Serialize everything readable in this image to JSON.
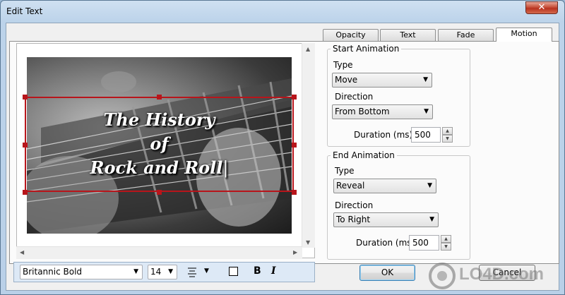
{
  "window": {
    "title": "Edit Text",
    "close_glyph": "✕"
  },
  "tabs": [
    {
      "label": "Opacity",
      "active": false
    },
    {
      "label": "Text",
      "active": false
    },
    {
      "label": "Fade",
      "active": false
    },
    {
      "label": "Motion",
      "active": true
    }
  ],
  "preview": {
    "text_lines": [
      "The History",
      "of",
      "Rock and Roll"
    ],
    "cursor": "|"
  },
  "start_animation": {
    "legend": "Start Animation",
    "type_label": "Type",
    "type_value": "Move",
    "direction_label": "Direction",
    "direction_value": "From Bottom",
    "duration_label": "Duration (ms)",
    "duration_value": "500"
  },
  "end_animation": {
    "legend": "End Animation",
    "type_label": "Type",
    "type_value": "Reveal",
    "direction_label": "Direction",
    "direction_value": "To Right",
    "duration_label": "Duration (ms)",
    "duration_value": "500"
  },
  "text_toolbar": {
    "font": "Britannic Bold",
    "size": "14",
    "bold": "B",
    "italic": "I"
  },
  "buttons": {
    "ok": "OK",
    "cancel": "Cancel"
  },
  "watermark": {
    "text": "LO4D.com"
  },
  "colors": {
    "selection": "#b8151b",
    "accent": "#3c7fb1"
  }
}
